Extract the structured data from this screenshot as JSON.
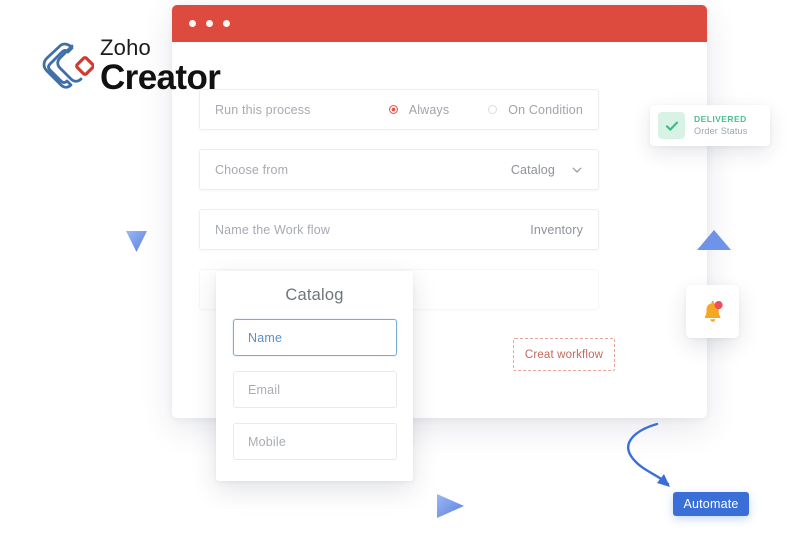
{
  "brand": {
    "name_top": "Zoho",
    "name_bottom": "Creator",
    "logo_icon": "zoho-creator-logo-icon",
    "logo_blue": "#3f6fa8",
    "logo_red": "#cf3b33"
  },
  "window": {
    "titlebar_color": "#dd4b3e",
    "dots": [
      "window-dot-1",
      "window-dot-2",
      "window-dot-3"
    ]
  },
  "form": {
    "rows": [
      {
        "label": "Run this process",
        "type": "radio",
        "options": [
          {
            "label": "Always",
            "selected": true
          },
          {
            "label": "On Condition",
            "selected": false
          }
        ]
      },
      {
        "label": "Choose from",
        "type": "dropdown",
        "value": "Catalog",
        "icon": "chevron-down-icon"
      },
      {
        "label": "Name the Work flow",
        "type": "text",
        "value": "Inventory"
      },
      {
        "label": "",
        "type": "text",
        "value": ""
      }
    ]
  },
  "catalog_card": {
    "title": "Catalog",
    "fields": [
      {
        "placeholder": "Name",
        "focused": true
      },
      {
        "placeholder": "Email",
        "focused": false
      },
      {
        "placeholder": "Mobile",
        "focused": false
      }
    ],
    "focus_color": "#7aaed8"
  },
  "create_workflow": {
    "label": "Creat workflow",
    "border_color": "#e8a497",
    "text_color": "#c4695c"
  },
  "delivered_badge": {
    "icon": "check-icon",
    "status": "DELIVERED",
    "caption": "Order Status",
    "accent": "#4dbf8e",
    "icon_bg": "#d8f3e5"
  },
  "notification": {
    "icon": "bell-icon",
    "badge_icon": "notification-dot-icon",
    "bell_color": "#f5a623",
    "dot_color": "#ee4e5a"
  },
  "automate_button": {
    "label": "Automate",
    "color": "#3a6fd8",
    "text_color": "#ffffff"
  },
  "decorations": {
    "dashed_curve_color": "#c9ccd1",
    "arrow_color": "#3a6fd8",
    "triangles": [
      {
        "name": "triangle-down-left",
        "direction": "down"
      },
      {
        "name": "triangle-up-right",
        "direction": "up"
      },
      {
        "name": "triangle-right-bottom",
        "direction": "right"
      }
    ]
  }
}
